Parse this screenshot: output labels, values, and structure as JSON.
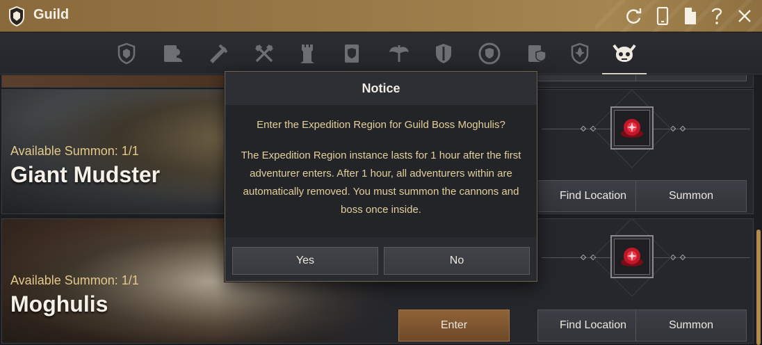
{
  "window": {
    "title": "Guild"
  },
  "tabs": [
    {
      "icon": "guild-crest-icon"
    },
    {
      "icon": "scroll-person-icon"
    },
    {
      "icon": "quill-map-icon"
    },
    {
      "icon": "crossed-axes-icon"
    },
    {
      "icon": "tower-icon"
    },
    {
      "icon": "shield-document-icon"
    },
    {
      "icon": "winged-axe-icon"
    },
    {
      "icon": "sword-shield-icon"
    },
    {
      "icon": "round-emblem-icon"
    },
    {
      "icon": "scroll-shield-icon"
    },
    {
      "icon": "fleur-shield-icon"
    },
    {
      "icon": "boss-skull-icon",
      "active": true
    }
  ],
  "bosses": [
    {
      "available": "Available Summon: 1/1",
      "name": "Giant Mudster"
    },
    {
      "available": "Available Summon: 1/1",
      "name": "Moghulis"
    }
  ],
  "buttons": {
    "enter": "Enter",
    "find_location": "Find Location",
    "summon": "Summon"
  },
  "dialog": {
    "title": "Notice",
    "question": "Enter the Expedition Region for Guild Boss Moghulis?",
    "body": "The Expedition Region instance lasts for 1 hour after the first adventurer enters. After 1 hour, all adventurers within are automatically removed. You must summon the cannons and boss once inside.",
    "yes": "Yes",
    "no": "No"
  },
  "colors": {
    "title_bar": "#9a7a48",
    "accent_gold": "#b48a4e",
    "enter_button": "#8f6338",
    "dialog_text": "#e3cf9e",
    "reward_gem": "#c0182a"
  }
}
